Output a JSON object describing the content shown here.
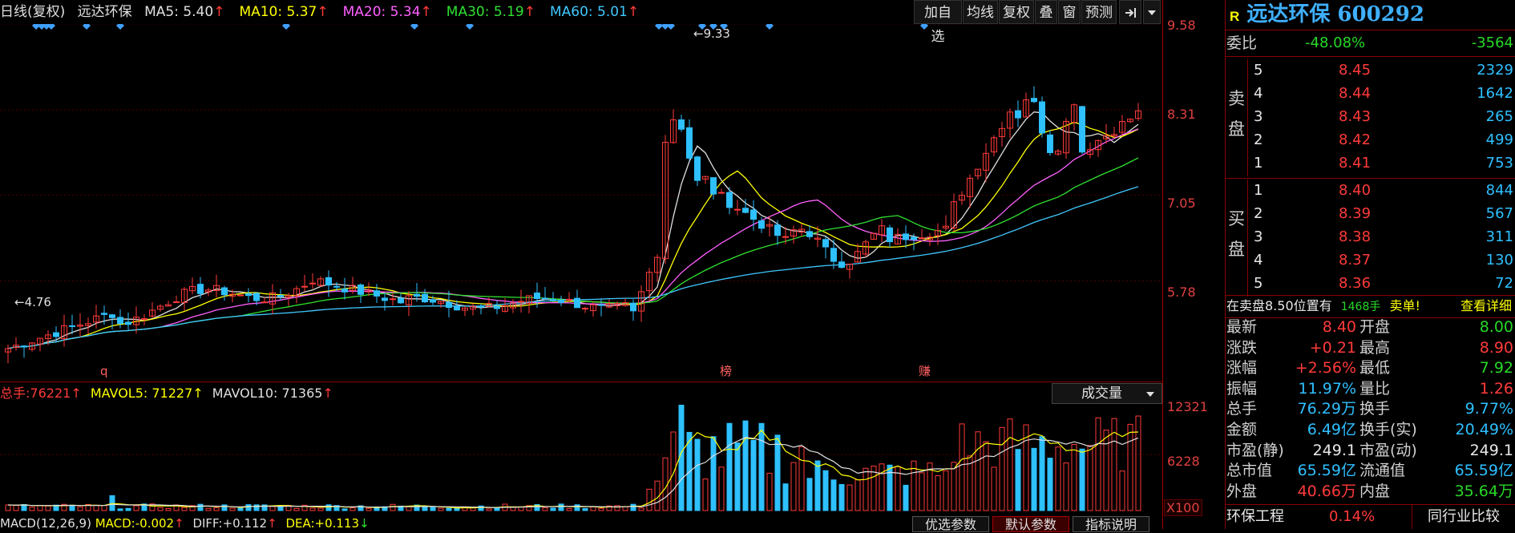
{
  "chart_header": {
    "period": "日线(复权)",
    "stock_name": "远达环保",
    "ma": [
      {
        "label": "MA5:",
        "value": "5.40",
        "arrow": "↑",
        "color": "#e0e0e0"
      },
      {
        "label": "MA10:",
        "value": "5.37",
        "arrow": "↑",
        "color": "#ffff00"
      },
      {
        "label": "MA20:",
        "value": "5.34",
        "arrow": "↑",
        "color": "#ff60ff"
      },
      {
        "label": "MA30:",
        "value": "5.19",
        "arrow": "↑",
        "color": "#30e030"
      },
      {
        "label": "MA60:",
        "value": "5.01",
        "arrow": "↑",
        "color": "#40c8ff"
      }
    ]
  },
  "toolbar": {
    "buttons": [
      "加自选",
      "均线",
      "复权",
      "叠",
      "窗",
      "预测"
    ],
    "exit_icon": "exit-fullscreen-icon",
    "dropdown_icon": "chevron-down-icon"
  },
  "price_axis": {
    "ticks": [
      "9.58",
      "8.31",
      "7.05",
      "5.78"
    ]
  },
  "price_annotations": {
    "high": "9.33",
    "low": "4.76"
  },
  "event_markers": [
    "q",
    "榜",
    "赚"
  ],
  "volume_header": {
    "total_label": "总手:",
    "total_value": "76221",
    "total_arrow": "↑",
    "mavol5_label": "MAVOL5:",
    "mavol5_value": "71227",
    "mavol5_arrow": "↑",
    "mavol10_label": "MAVOL10:",
    "mavol10_value": "71365",
    "mavol10_arrow": "↑",
    "selector": "成交量"
  },
  "volume_axis": {
    "ticks": [
      "12321",
      "6228"
    ],
    "unit": "X100"
  },
  "macd_header": {
    "label": "MACD(12,26,9)",
    "macd_label": "MACD:",
    "macd_value": "-0.002",
    "macd_arrow": "↑",
    "diff_label": "DIFF:",
    "diff_value": "+0.112",
    "diff_arrow": "↑",
    "dea_label": "DEA:",
    "dea_value": "+0.113",
    "dea_arrow": "↓"
  },
  "bottom_tabs": [
    "优选参数",
    "默认参数",
    "指标说明"
  ],
  "quote": {
    "badge": "R",
    "title": "远达环保 600292",
    "weibi_label": "委比",
    "weibi_pct": "-48.08%",
    "weibi_diff": "-3564",
    "sell_label": "卖盘",
    "buy_label": "买盘",
    "sell": [
      {
        "level": "5",
        "price": "8.45",
        "vol": "2329"
      },
      {
        "level": "4",
        "price": "8.44",
        "vol": "1642"
      },
      {
        "level": "3",
        "price": "8.43",
        "vol": "265"
      },
      {
        "level": "2",
        "price": "8.42",
        "vol": "499"
      },
      {
        "level": "1",
        "price": "8.41",
        "vol": "753"
      }
    ],
    "buy": [
      {
        "level": "1",
        "price": "8.40",
        "vol": "844"
      },
      {
        "level": "2",
        "price": "8.39",
        "vol": "567"
      },
      {
        "level": "3",
        "price": "8.38",
        "vol": "311"
      },
      {
        "level": "4",
        "price": "8.37",
        "vol": "130"
      },
      {
        "level": "5",
        "price": "8.36",
        "vol": "72"
      }
    ],
    "notice_prefix": "在卖盘8.50位置有",
    "notice_qty": "1468手",
    "notice_suffix": "卖单!",
    "notice_link": "查看详细",
    "stats": [
      {
        "l1": "最新",
        "v1": "8.40",
        "c1": "red",
        "l2": "开盘",
        "v2": "8.00",
        "c2": "green"
      },
      {
        "l1": "涨跌",
        "v1": "+0.21",
        "c1": "red",
        "l2": "最高",
        "v2": "8.90",
        "c2": "red"
      },
      {
        "l1": "涨幅",
        "v1": "+2.56%",
        "c1": "red",
        "l2": "最低",
        "v2": "7.92",
        "c2": "green"
      },
      {
        "l1": "振幅",
        "v1": "11.97%",
        "c1": "cyan",
        "l2": "量比",
        "v2": "1.26",
        "c2": "red"
      },
      {
        "l1": "总手",
        "v1": "76.29万",
        "c1": "cyan",
        "l2": "换手",
        "v2": "9.77%",
        "c2": "cyan"
      },
      {
        "l1": "金额",
        "v1": "6.49亿",
        "c1": "cyan",
        "l2": "换手(实)",
        "v2": "20.49%",
        "c2": "cyan"
      },
      {
        "l1": "市盈(静)",
        "v1": "249.1",
        "c1": "white",
        "l2": "市盈(动)",
        "v2": "249.1",
        "c2": "white"
      },
      {
        "l1": "总市值",
        "v1": "65.59亿",
        "c1": "cyan",
        "l2": "流通值",
        "v2": "65.59亿",
        "c2": "cyan"
      },
      {
        "l1": "外盘",
        "v1": "40.66万",
        "c1": "red",
        "l2": "内盘",
        "v2": "35.64万",
        "c2": "green"
      }
    ],
    "sector": "环保工程",
    "sector_pct": "0.14%",
    "sector_link": "同行业比较"
  },
  "colors": {
    "up": "#ff3a3a",
    "down": "#2ec0ff",
    "grid": "#8a0000",
    "ma5": "#e0e0e0",
    "ma10": "#ffff00",
    "ma20": "#ff60ff",
    "ma30": "#30e030",
    "ma60": "#40c8ff"
  }
}
